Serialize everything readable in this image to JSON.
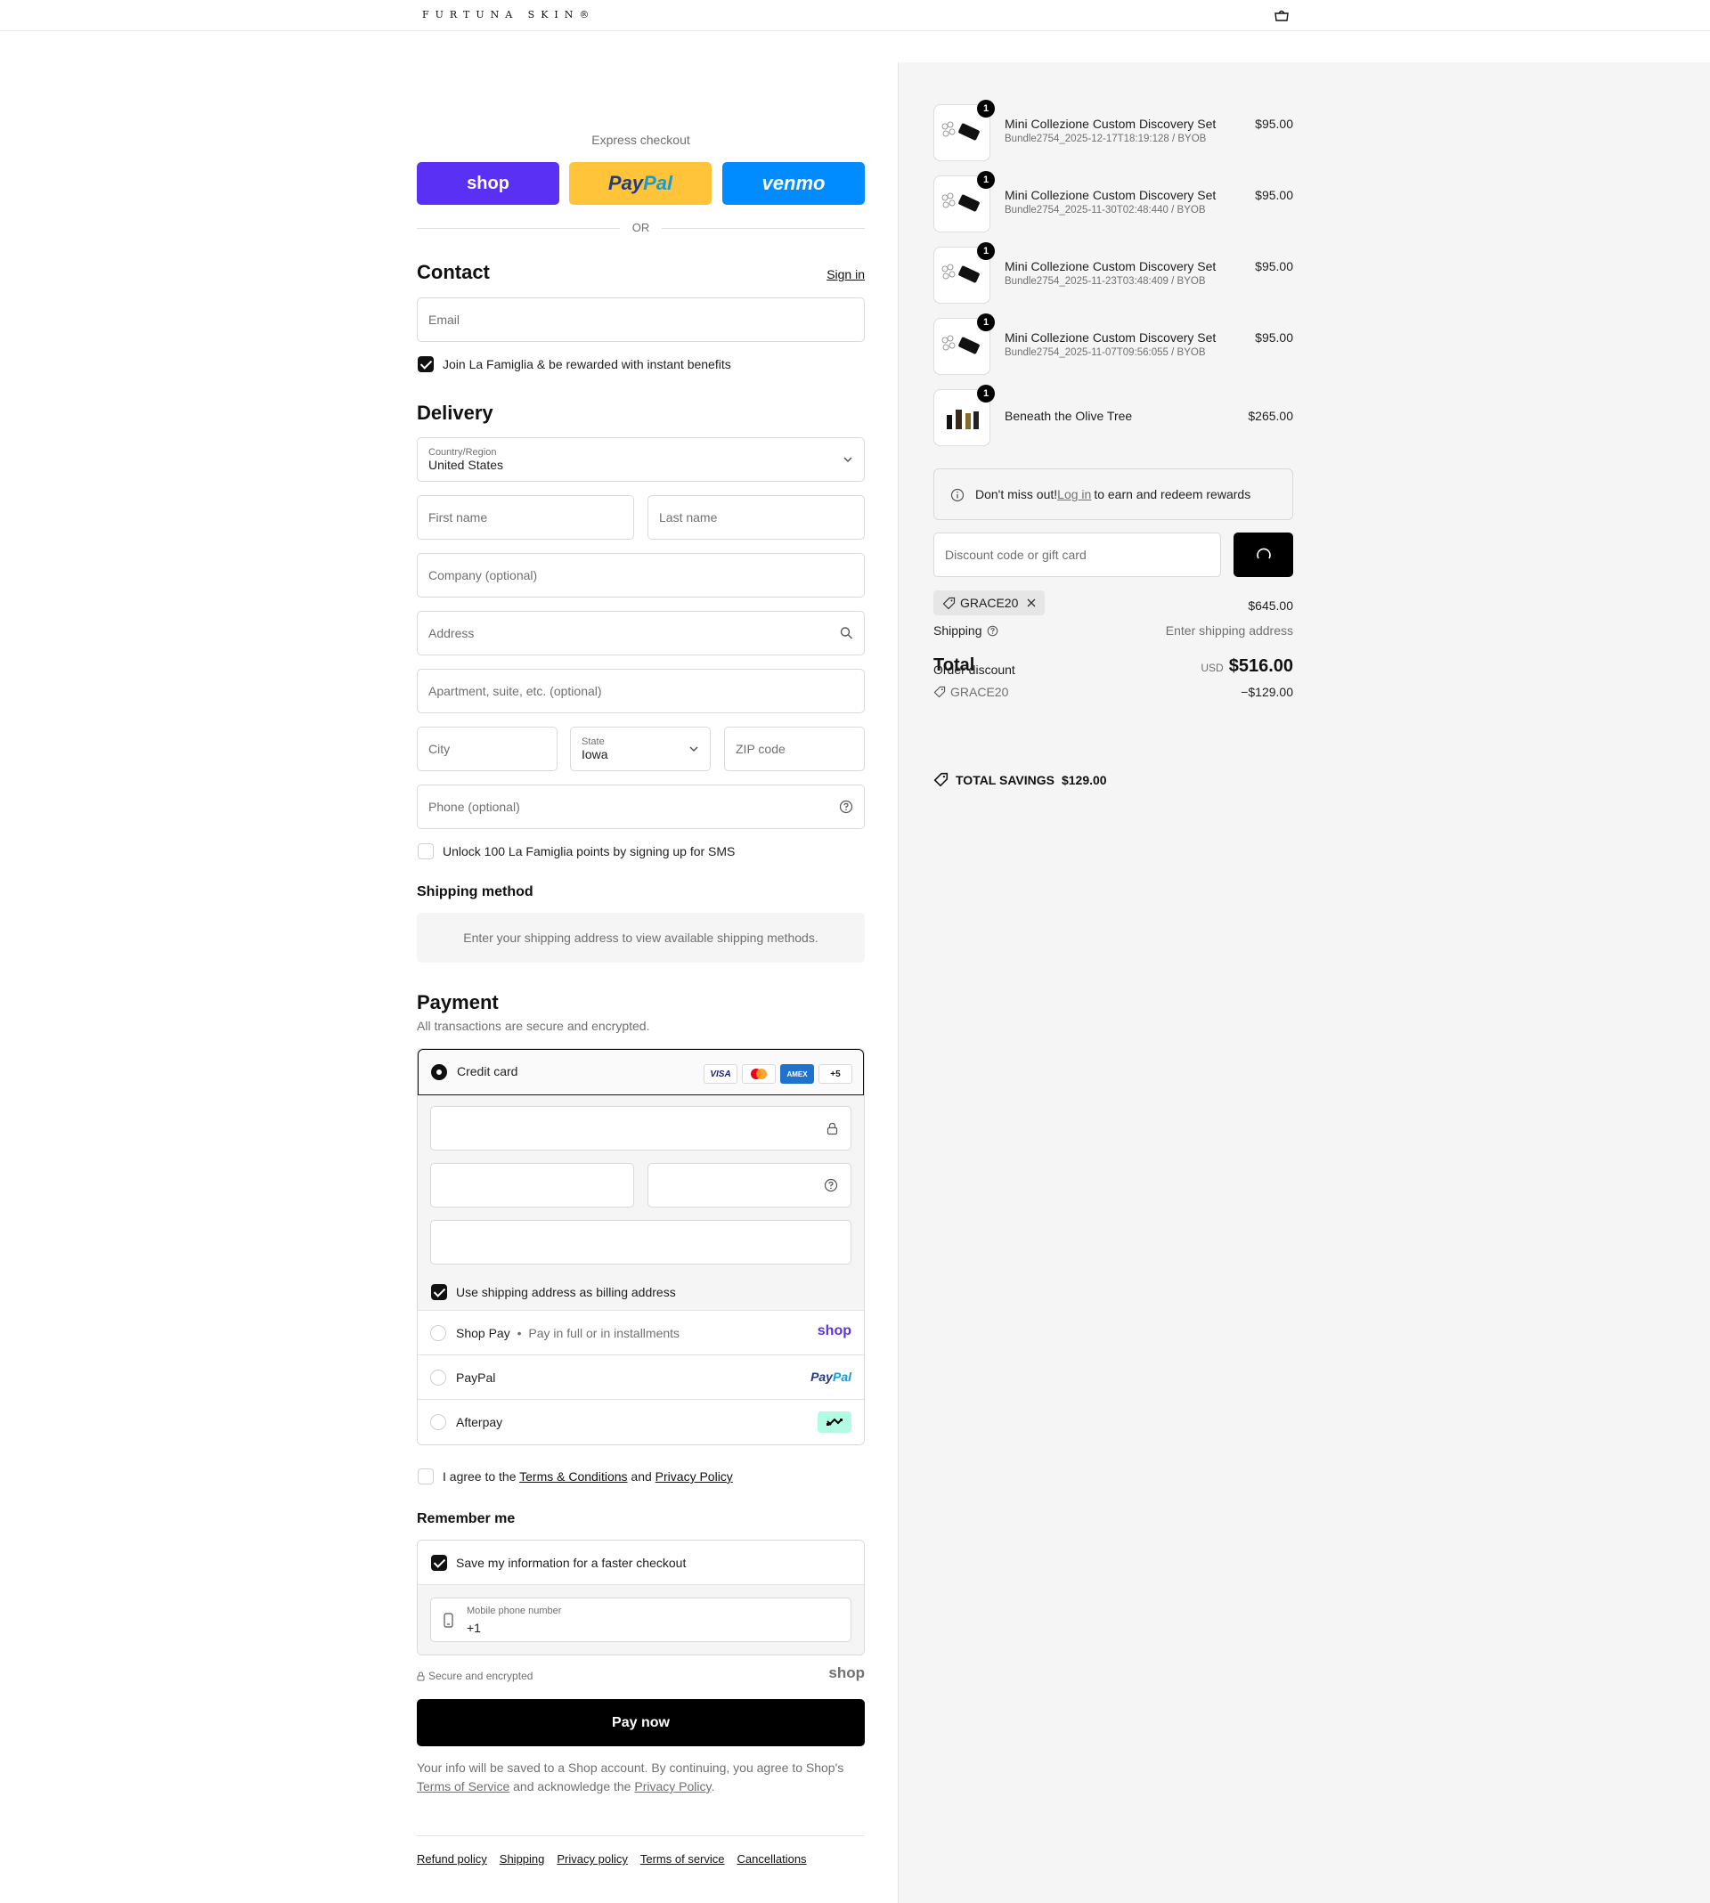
{
  "header": {
    "brand": "FURTUNA SKIN®"
  },
  "express": {
    "title": "Express checkout",
    "shop_label": "shop",
    "paypal_a": "Pay",
    "paypal_b": "Pal",
    "venmo_label": "venmo",
    "or": "OR"
  },
  "contact": {
    "heading": "Contact",
    "sign_in": "Sign in",
    "email_placeholder": "Email",
    "newsletter": "Join La Famiglia & be rewarded with instant benefits"
  },
  "delivery": {
    "heading": "Delivery",
    "country_label": "Country/Region",
    "country_value": "United States",
    "first_name": "First name",
    "last_name": "Last name",
    "company": "Company (optional)",
    "address": "Address",
    "apartment": "Apartment, suite, etc. (optional)",
    "city": "City",
    "state_label": "State",
    "state_value": "Iowa",
    "zip": "ZIP code",
    "phone": "Phone (optional)",
    "sms": "Unlock 100 La Famiglia points by signing up for SMS"
  },
  "shipping_method": {
    "heading": "Shipping method",
    "message": "Enter your shipping address to view available shipping methods."
  },
  "payment": {
    "heading": "Payment",
    "subtitle": "All transactions are secure and encrypted.",
    "credit_card": "Credit card",
    "card_visa": "VISA",
    "card_amex": "AMEX",
    "card_more": "+5",
    "billing": "Use shipping address as billing address",
    "shop_pay": "Shop Pay",
    "shop_pay_sub": "Pay in full or in installments",
    "shop_pay_logo": "shop",
    "paypal": "PayPal",
    "paypal_logo_a": "Pay",
    "paypal_logo_b": "Pal",
    "afterpay": "Afterpay"
  },
  "agree": {
    "prefix": "I agree to the ",
    "terms": "Terms & Conditions",
    "and": " and ",
    "privacy": "Privacy Policy"
  },
  "remember": {
    "heading": "Remember me",
    "save_info": "Save my information for a faster checkout",
    "phone_label": "Mobile phone number",
    "phone_value": "+1",
    "secure": "Secure and encrypted",
    "shop_logo": "shop"
  },
  "pay_now": "Pay now",
  "legal": {
    "line1": "Your info will be saved to a Shop account. By continuing, you agree to Shop's",
    "terms": "Terms of Service",
    "mid": " and acknowledge the ",
    "privacy": "Privacy Policy",
    "end": "."
  },
  "footer_links": [
    "Refund policy",
    "Shipping",
    "Privacy policy",
    "Terms of service",
    "Cancellations"
  ],
  "cart": {
    "items": [
      {
        "qty": "1",
        "name": "Mini Collezione Custom Discovery Set",
        "sub": "Bundle2754_2025-12-17T18:19:128 / BYOB",
        "price": "$95.00"
      },
      {
        "qty": "1",
        "name": "Mini Collezione Custom Discovery Set",
        "sub": "Bundle2754_2025-11-30T02:48:440 / BYOB",
        "price": "$95.00"
      },
      {
        "qty": "1",
        "name": "Mini Collezione Custom Discovery Set",
        "sub": "Bundle2754_2025-11-23T03:48:409 / BYOB",
        "price": "$95.00"
      },
      {
        "qty": "1",
        "name": "Mini Collezione Custom Discovery Set",
        "sub": "Bundle2754_2025-11-07T09:56:055 / BYOB",
        "price": "$95.00"
      },
      {
        "qty": "1",
        "name": "Beneath the Olive Tree",
        "sub": "",
        "price": "$265.00"
      }
    ],
    "notice_a": "Don't miss out! ",
    "notice_link": "Log in",
    "notice_b": " to earn and redeem rewards",
    "discount_placeholder": "Discount code or gift card",
    "code": "GRACE20",
    "subtotal_value": "$645.00",
    "shipping_label": "Shipping",
    "shipping_value": "Enter shipping address",
    "total_label": "Total",
    "order_discount_label": "Order discount",
    "currency": "USD",
    "total_value": "$516.00",
    "discount_code": "GRACE20",
    "discount_value": "−$129.00",
    "savings_label": "TOTAL SAVINGS",
    "savings_value": "$129.00"
  }
}
